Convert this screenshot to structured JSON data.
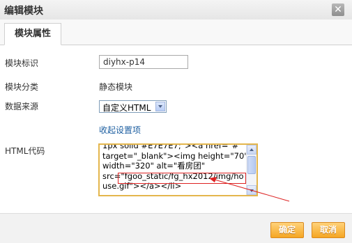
{
  "dialog": {
    "title": "编辑模块",
    "close_symbol": "✕"
  },
  "tabs": [
    {
      "label": "模块属性",
      "active": true
    }
  ],
  "fields": {
    "module_id": {
      "label": "模块标识",
      "value": "diyhx-p14"
    },
    "module_category": {
      "label": "模块分类",
      "value": "静态模块"
    },
    "data_source": {
      "label": "数据来源",
      "selected": "自定义HTML"
    },
    "collapse_link": "收起设置项",
    "html_code": {
      "label": "HTML代码",
      "lines": [
        "1px solid #E7E7E7;\"><a href=\"#\"",
        "target=\"_blank\"><img height=\"70\"",
        "width=\"320\" alt=\"看房团\"",
        "src=\"fgoo_static/fg_hx2012/img/ho",
        "use.gif\"></a></li>"
      ]
    }
  },
  "buttons": {
    "ok": "确定",
    "cancel": "取消"
  },
  "colors": {
    "accent": "#f5a623",
    "link": "#1c5ea0",
    "annotation": "#dd2222",
    "code_border": "#e4b64c"
  }
}
